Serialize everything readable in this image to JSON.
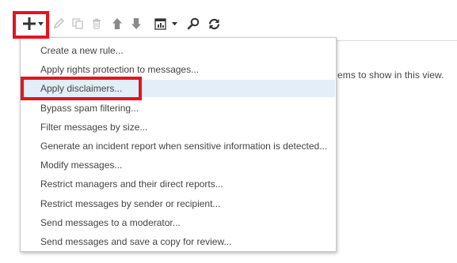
{
  "toolbar": {
    "icons": [
      "add-icon",
      "chevron-down-icon",
      "edit-icon",
      "copy-icon",
      "delete-icon",
      "move-up-icon",
      "move-down-icon",
      "report-icon",
      "chevron-down-icon",
      "search-icon",
      "refresh-icon"
    ]
  },
  "list": {
    "empty_message": "ems to show in this view."
  },
  "menu": {
    "items": [
      {
        "label": "Create a new rule..."
      },
      {
        "label": "Apply rights protection to messages..."
      },
      {
        "label": "Apply disclaimers..."
      },
      {
        "label": "Bypass spam filtering..."
      },
      {
        "label": "Filter messages by size..."
      },
      {
        "label": "Generate an incident report when sensitive information is detected..."
      },
      {
        "label": "Modify messages..."
      },
      {
        "label": "Restrict managers and their direct reports..."
      },
      {
        "label": "Restrict messages by sender or recipient..."
      },
      {
        "label": "Send messages to a moderator..."
      },
      {
        "label": "Send messages and save a copy for review..."
      }
    ],
    "selected_index": 2
  },
  "colors": {
    "highlight_box": "#e2151f",
    "selected_item_bg": "#e3eef9",
    "icon_active": "#333333",
    "icon_disabled": "#c4c4c4",
    "icon_mid": "#8a8a8a"
  }
}
